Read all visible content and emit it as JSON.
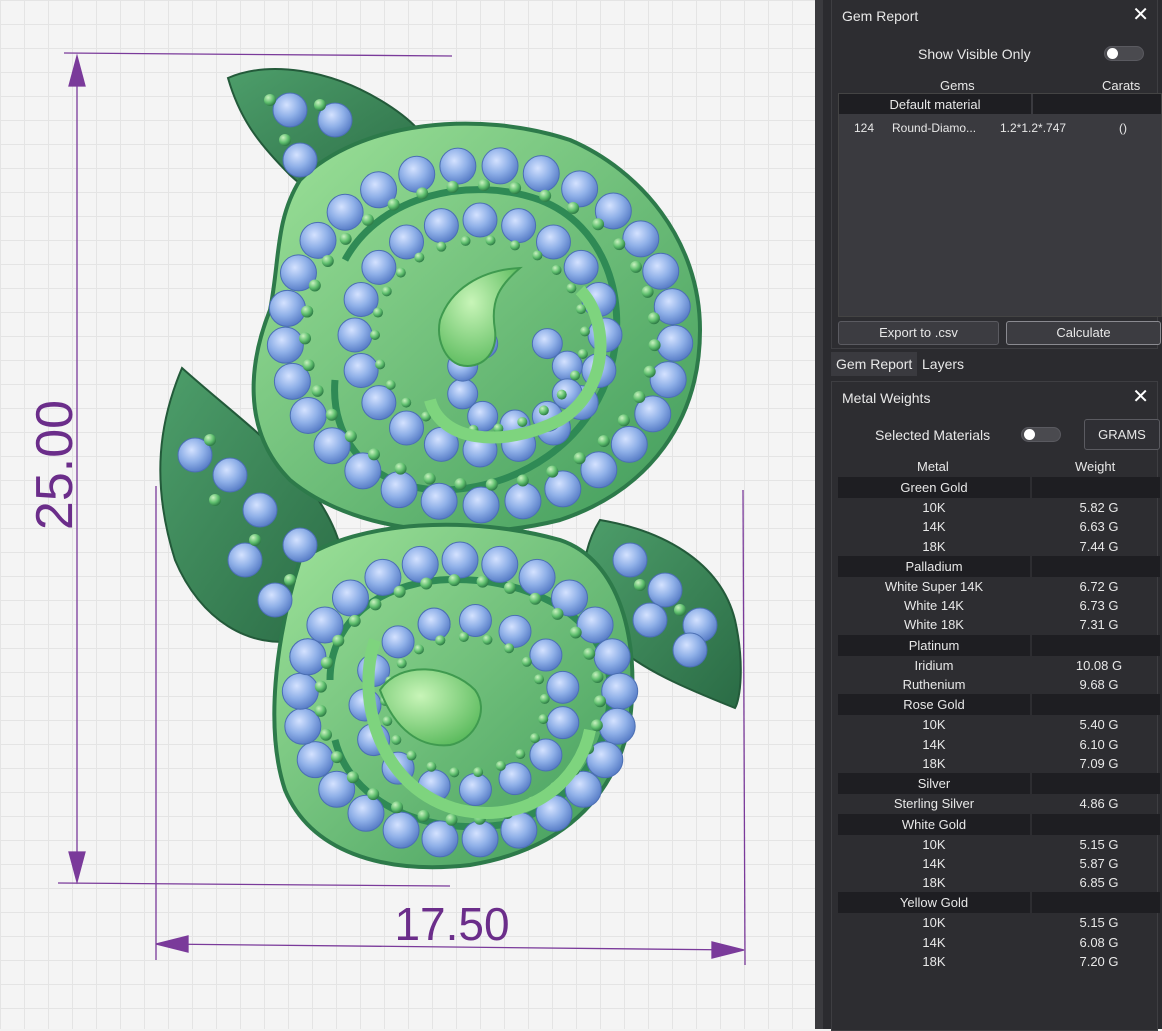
{
  "viewport": {
    "dimension_height": "25.00",
    "dimension_width": "17.50",
    "dimension_color": "#6b2d8a",
    "metal_colors": {
      "light": "#8ed98a",
      "mid": "#4fae63",
      "dark": "#2e7a4e"
    },
    "gem_color": "#8fb0e8"
  },
  "gem_report": {
    "title": "Gem Report",
    "close_icon": "close-icon",
    "show_visible_only_label": "Show Visible Only",
    "columns": {
      "gems": "Gems",
      "carats": "Carats"
    },
    "group": "Default material",
    "rows": [
      {
        "count": "124",
        "name": "Round-Diamo...",
        "size": "1.2*1.2*.747",
        "carats": "()"
      }
    ],
    "export_label": "Export to .csv",
    "calculate_label": "Calculate"
  },
  "tabs": [
    {
      "label": "Gem Report"
    },
    {
      "label": "Layers"
    }
  ],
  "metal_weights": {
    "title": "Metal Weights",
    "close_icon": "close-icon",
    "selected_materials_label": "Selected Materials",
    "units_label": "GRAMS",
    "columns": {
      "metal": "Metal",
      "weight": "Weight"
    },
    "groups": [
      {
        "name": "Green Gold",
        "rows": [
          {
            "metal": "10K",
            "weight": "5.82 G"
          },
          {
            "metal": "14K",
            "weight": "6.63 G"
          },
          {
            "metal": "18K",
            "weight": "7.44 G"
          }
        ]
      },
      {
        "name": "Palladium",
        "rows": [
          {
            "metal": "White Super 14K",
            "weight": "6.72 G"
          },
          {
            "metal": "White 14K",
            "weight": "6.73 G"
          },
          {
            "metal": "White 18K",
            "weight": "7.31 G"
          }
        ]
      },
      {
        "name": "Platinum",
        "rows": [
          {
            "metal": "Iridium",
            "weight": "10.08 G"
          },
          {
            "metal": "Ruthenium",
            "weight": "9.68 G"
          }
        ]
      },
      {
        "name": "Rose Gold",
        "rows": [
          {
            "metal": "10K",
            "weight": "5.40 G"
          },
          {
            "metal": "14K",
            "weight": "6.10 G"
          },
          {
            "metal": "18K",
            "weight": "7.09 G"
          }
        ]
      },
      {
        "name": "Silver",
        "rows": [
          {
            "metal": "Sterling Silver",
            "weight": "4.86 G"
          }
        ]
      },
      {
        "name": "White Gold",
        "rows": [
          {
            "metal": "10K",
            "weight": "5.15 G"
          },
          {
            "metal": "14K",
            "weight": "5.87 G"
          },
          {
            "metal": "18K",
            "weight": "6.85 G"
          }
        ]
      },
      {
        "name": "Yellow Gold",
        "rows": [
          {
            "metal": "10K",
            "weight": "5.15 G"
          },
          {
            "metal": "14K",
            "weight": "6.08 G"
          },
          {
            "metal": "18K",
            "weight": "7.20 G"
          }
        ]
      }
    ]
  }
}
